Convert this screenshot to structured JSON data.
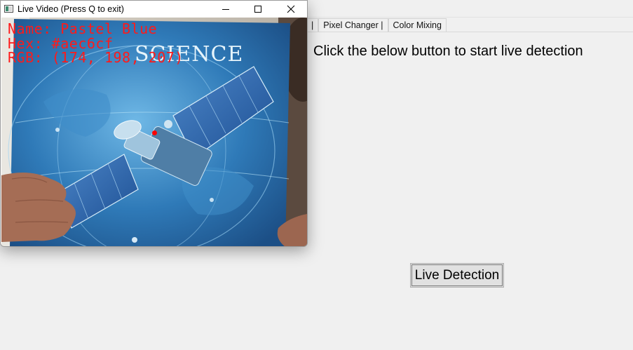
{
  "app": {
    "tabs": [
      "|",
      "Pixel Changer |",
      "Color Mixing"
    ],
    "instruction": "Click the below button to start live detection",
    "live_button": "Live Detection"
  },
  "video_window": {
    "title": "Live Video (Press Q to exit)",
    "controls": [
      "minimize-icon",
      "maximize-icon",
      "close-icon"
    ],
    "overlay": {
      "name_line": "Name: Pastel Blue",
      "hex_line": "Hex: #aec6cf",
      "rgb_line": "RGB: (174, 198, 207)",
      "text_color": "#ff1a1a"
    },
    "book_text": "SCIENCE"
  },
  "colors": {
    "window_bg": "#f0f0f0",
    "overlay_red": "#ff1a1a",
    "book_blue": "#2a6fa8"
  }
}
